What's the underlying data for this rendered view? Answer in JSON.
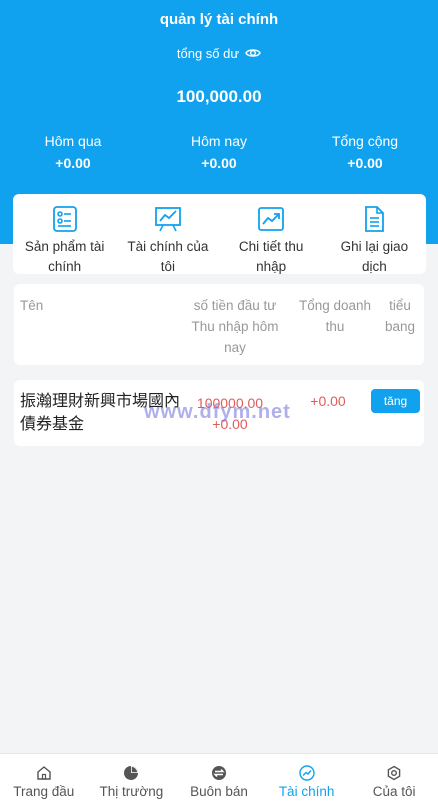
{
  "header": {
    "title": "quản lý tài chính",
    "balance_label": "tổng số dư",
    "balance": "100,000.00",
    "stats": [
      {
        "label": "Hôm qua",
        "value": "+0.00"
      },
      {
        "label": "Hôm nay",
        "value": "+0.00"
      },
      {
        "label": "Tổng cộng",
        "value": "+0.00"
      }
    ]
  },
  "menu": [
    {
      "label": "Sản phẩm tài chính",
      "icon": "product-list-icon"
    },
    {
      "label": "Tài chính của tôi",
      "icon": "chart-board-icon"
    },
    {
      "label": "Chi tiết thu nhập",
      "icon": "trend-up-icon"
    },
    {
      "label": "Ghi lại giao dịch",
      "icon": "document-icon"
    }
  ],
  "table": {
    "headers": {
      "name": "Tên",
      "invest": "số tiền đầu tư Thu nhập hôm nay",
      "revenue": "Tổng doanh thu",
      "level": "tiểu bang"
    },
    "rows": [
      {
        "name": "振瀚理財新興市場國內債券基金",
        "invest": "100000.00",
        "today": "+0.00",
        "revenue": "+0.00",
        "action": "tăng"
      }
    ]
  },
  "watermark": "www.dfym.net",
  "tabbar": [
    {
      "label": "Trang đầu",
      "icon": "home-icon"
    },
    {
      "label": "Thị trường",
      "icon": "pie-chart-icon"
    },
    {
      "label": "Buôn bán",
      "icon": "exchange-icon"
    },
    {
      "label": "Tài chính",
      "icon": "finance-trend-icon",
      "active": true
    },
    {
      "label": "Của tôi",
      "icon": "settings-gear-icon"
    }
  ],
  "colors": {
    "primary": "#10a2ee",
    "value": "#e05c5c",
    "muted": "#999999"
  }
}
